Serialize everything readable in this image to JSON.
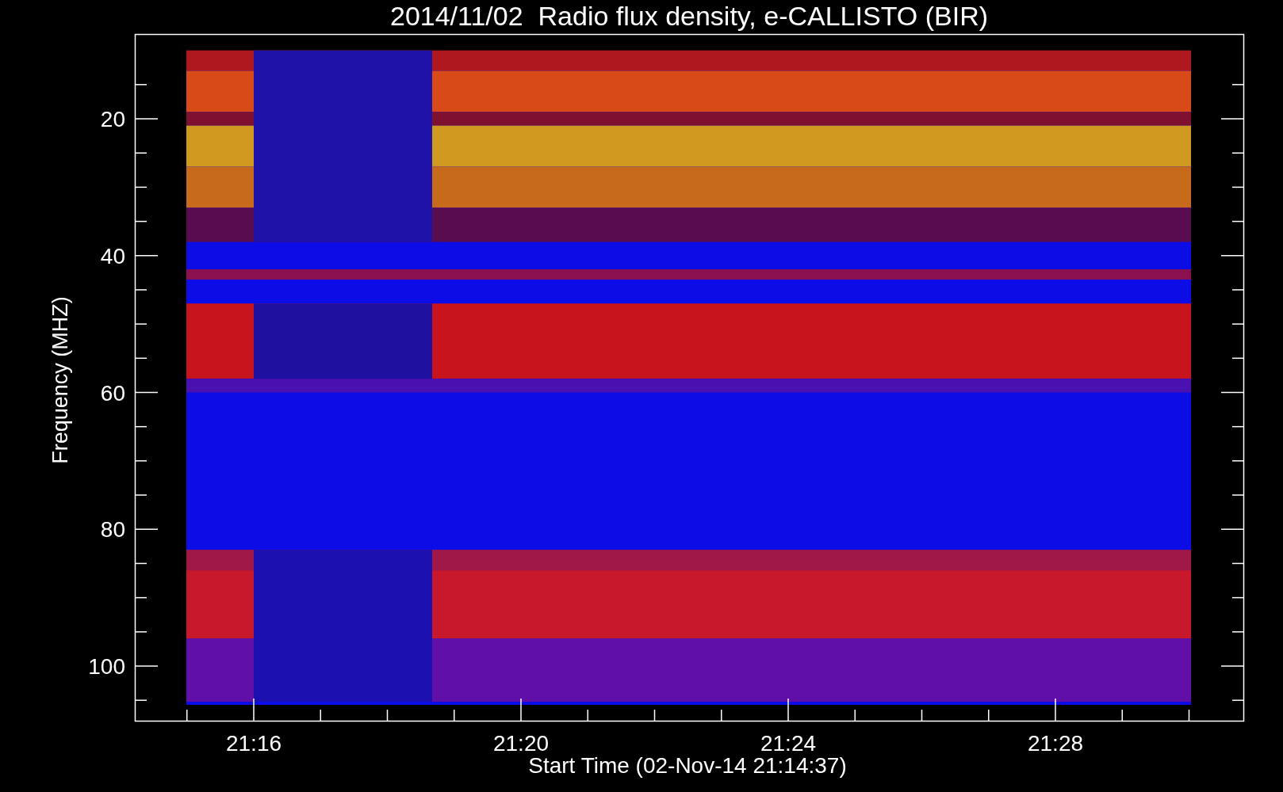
{
  "title": "2014/11/02  Radio flux density, e-CALLISTO (BIR)",
  "y_axis": {
    "label": "Frequency (MHZ)",
    "ticks": [
      "20",
      "40",
      "60",
      "80",
      "100"
    ]
  },
  "x_axis": {
    "label": "Start Time (02-Nov-14 21:14:37)",
    "ticks": [
      "21:16",
      "21:20",
      "21:24",
      "21:28"
    ]
  }
}
